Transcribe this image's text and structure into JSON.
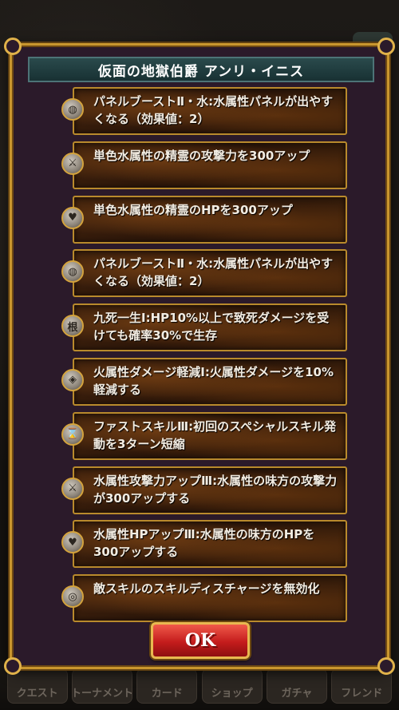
{
  "dialog": {
    "title": "仮面の地獄伯爵 アンリ・イニス",
    "ok_label": "OK"
  },
  "skills": [
    {
      "icon": "panel-icon",
      "glyph": "◍",
      "text": "パネルブーストⅡ・水:水属性パネルが出やすくなる（効果値：2）"
    },
    {
      "icon": "sword-icon",
      "glyph": "⚔",
      "text": "単色水属性の精霊の攻撃力を300アップ"
    },
    {
      "icon": "heart-icon",
      "glyph": "♥",
      "text": "単色水属性の精霊のHPを300アップ"
    },
    {
      "icon": "panel-icon",
      "glyph": "◍",
      "text": "パネルブーストⅡ・水:水属性パネルが出やすくなる（効果値：2）"
    },
    {
      "icon": "survive-icon",
      "glyph": "根",
      "text": "九死一生Ⅰ:HP10%以上で致死ダメージを受けても確率30%で生存"
    },
    {
      "icon": "shield-icon",
      "glyph": "◈",
      "text": "火属性ダメージ軽減Ⅰ:火属性ダメージを10%軽減する"
    },
    {
      "icon": "hourglass-icon",
      "glyph": "⌛",
      "text": "ファストスキルⅢ:初回のスペシャルスキル発動を3ターン短縮"
    },
    {
      "icon": "sword-icon",
      "glyph": "⚔",
      "text": "水属性攻撃力アップⅢ:水属性の味方の攻撃力が300アップする"
    },
    {
      "icon": "heart-icon",
      "glyph": "♥",
      "text": "水属性HPアップⅢ:水属性の味方のHPを300アップする"
    },
    {
      "icon": "discharge-icon",
      "glyph": "◎",
      "text": "敵スキルのスキルディスチャージを無効化"
    }
  ],
  "background_nav": [
    "クエスト",
    "トーナメント",
    "カード",
    "ショップ",
    "ガチャ",
    "フレンド"
  ],
  "colors": {
    "frame_gold": "#c9962e",
    "title_bar": "#1f3b3d",
    "ok_red": "#c41c1c",
    "skill_text": "#f2ece2"
  }
}
